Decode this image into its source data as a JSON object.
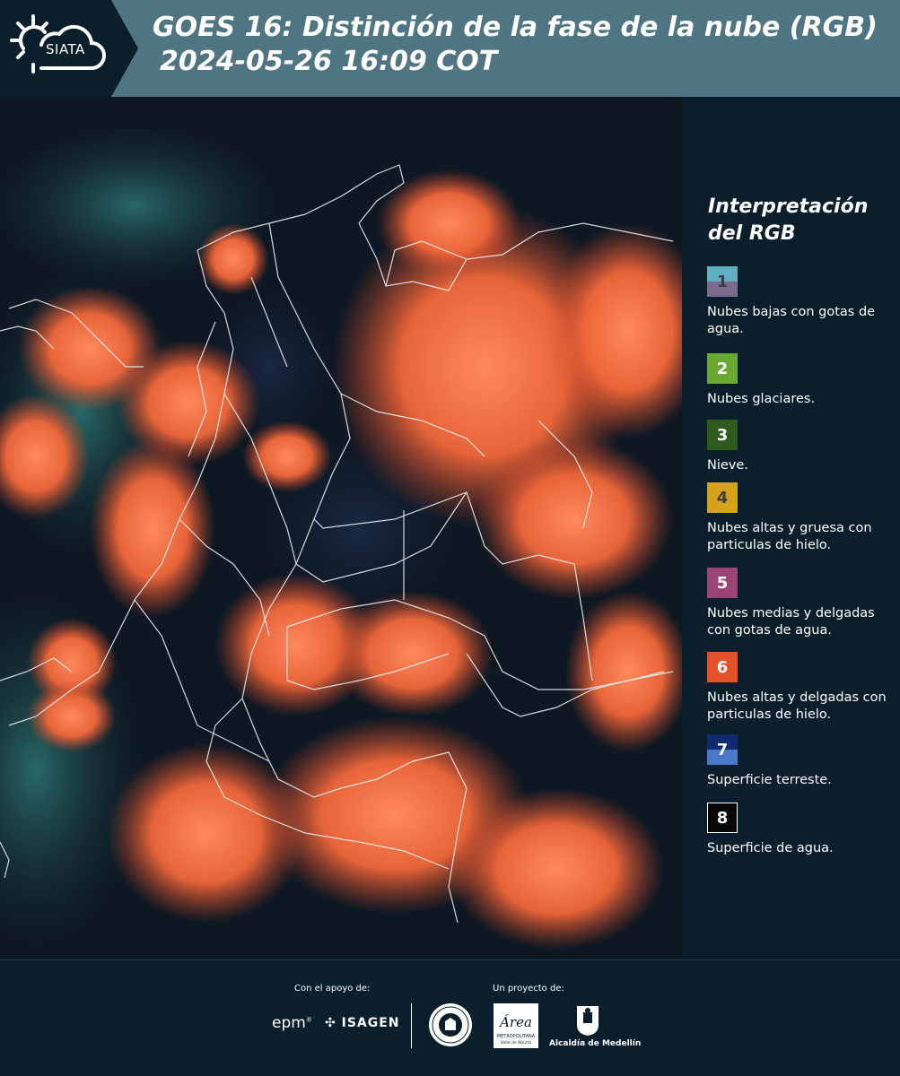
{
  "header": {
    "logo_text": "SIATA",
    "title_line1": "GOES 16: Distinción de la fase de la nube (RGB)",
    "title_line2": "2024-05-26 16:09 COT"
  },
  "legend": {
    "title": "Interpretación del RGB",
    "items": [
      {
        "number": "1",
        "label": "Nubes bajas con gotas de agua.",
        "color_top": "#5fb0c0",
        "color_bottom": "#7a6a8e"
      },
      {
        "number": "2",
        "label": "Nubes glaciares.",
        "color_top": "#6aa832",
        "color_bottom": "#6aa832"
      },
      {
        "number": "3",
        "label": "Nieve.",
        "color_top": "#2e5b1d",
        "color_bottom": "#2e5b1d"
      },
      {
        "number": "4",
        "label": "Nubes altas y gruesa con particulas de hielo.",
        "color_top": "#d6a21a",
        "color_bottom": "#d6a21a"
      },
      {
        "number": "5",
        "label": "Nubes medias y delgadas con gotas de agua.",
        "color_top": "#9b4373",
        "color_bottom": "#9b4373"
      },
      {
        "number": "6",
        "label": "Nubes altas y delgadas con particulas de hielo.",
        "color_top": "#e2512a",
        "color_bottom": "#e2512a"
      },
      {
        "number": "7",
        "label": "Superficie terreste.",
        "color_top": "#102a70",
        "color_bottom": "#4a78c8"
      },
      {
        "number": "8",
        "label": "Superficie de agua.",
        "color_top": "#080808",
        "color_bottom": "#080808"
      }
    ]
  },
  "footer": {
    "support_label": "Con el apoyo de:",
    "project_label": "Un proyecto de:",
    "sponsor_epm": "epm",
    "sponsor_isagen": "ISAGEN",
    "area_logo_text": "Área",
    "area_logo_subtext": "METROPOLITANA",
    "area_logo_subtext2": "Valle de Aburrá",
    "medellin_text": "Alcaldía de Medellín"
  },
  "colors": {
    "background": "#0b1e2b",
    "header": "#4f7583",
    "cloud_orange": "#f2683a",
    "land": "#101c2a"
  },
  "icons": {
    "logo": "sun-cloud-icon",
    "seal": "university-seal-icon",
    "area": "area-metropolitana-logo",
    "medellin": "medellin-crest-icon"
  }
}
